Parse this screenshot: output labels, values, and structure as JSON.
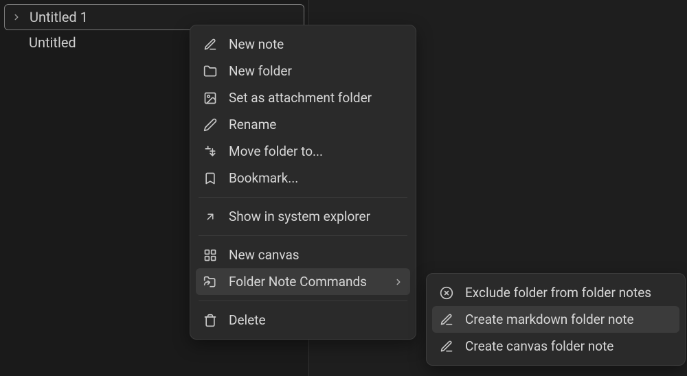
{
  "sidebar": {
    "items": [
      {
        "label": "Untitled 1",
        "selected": true,
        "has_children": true
      },
      {
        "label": "Untitled",
        "selected": false,
        "has_children": false
      }
    ]
  },
  "context_menu": {
    "items": [
      {
        "label": "New note"
      },
      {
        "label": "New folder"
      },
      {
        "label": "Set as attachment folder"
      },
      {
        "label": "Rename"
      },
      {
        "label": "Move folder to..."
      },
      {
        "label": "Bookmark..."
      },
      {
        "label": "Show in system explorer"
      },
      {
        "label": "New canvas"
      },
      {
        "label": "Folder Note Commands"
      },
      {
        "label": "Delete"
      }
    ]
  },
  "submenu": {
    "items": [
      {
        "label": "Exclude folder from folder notes"
      },
      {
        "label": "Create markdown folder note"
      },
      {
        "label": "Create canvas folder note"
      }
    ]
  }
}
